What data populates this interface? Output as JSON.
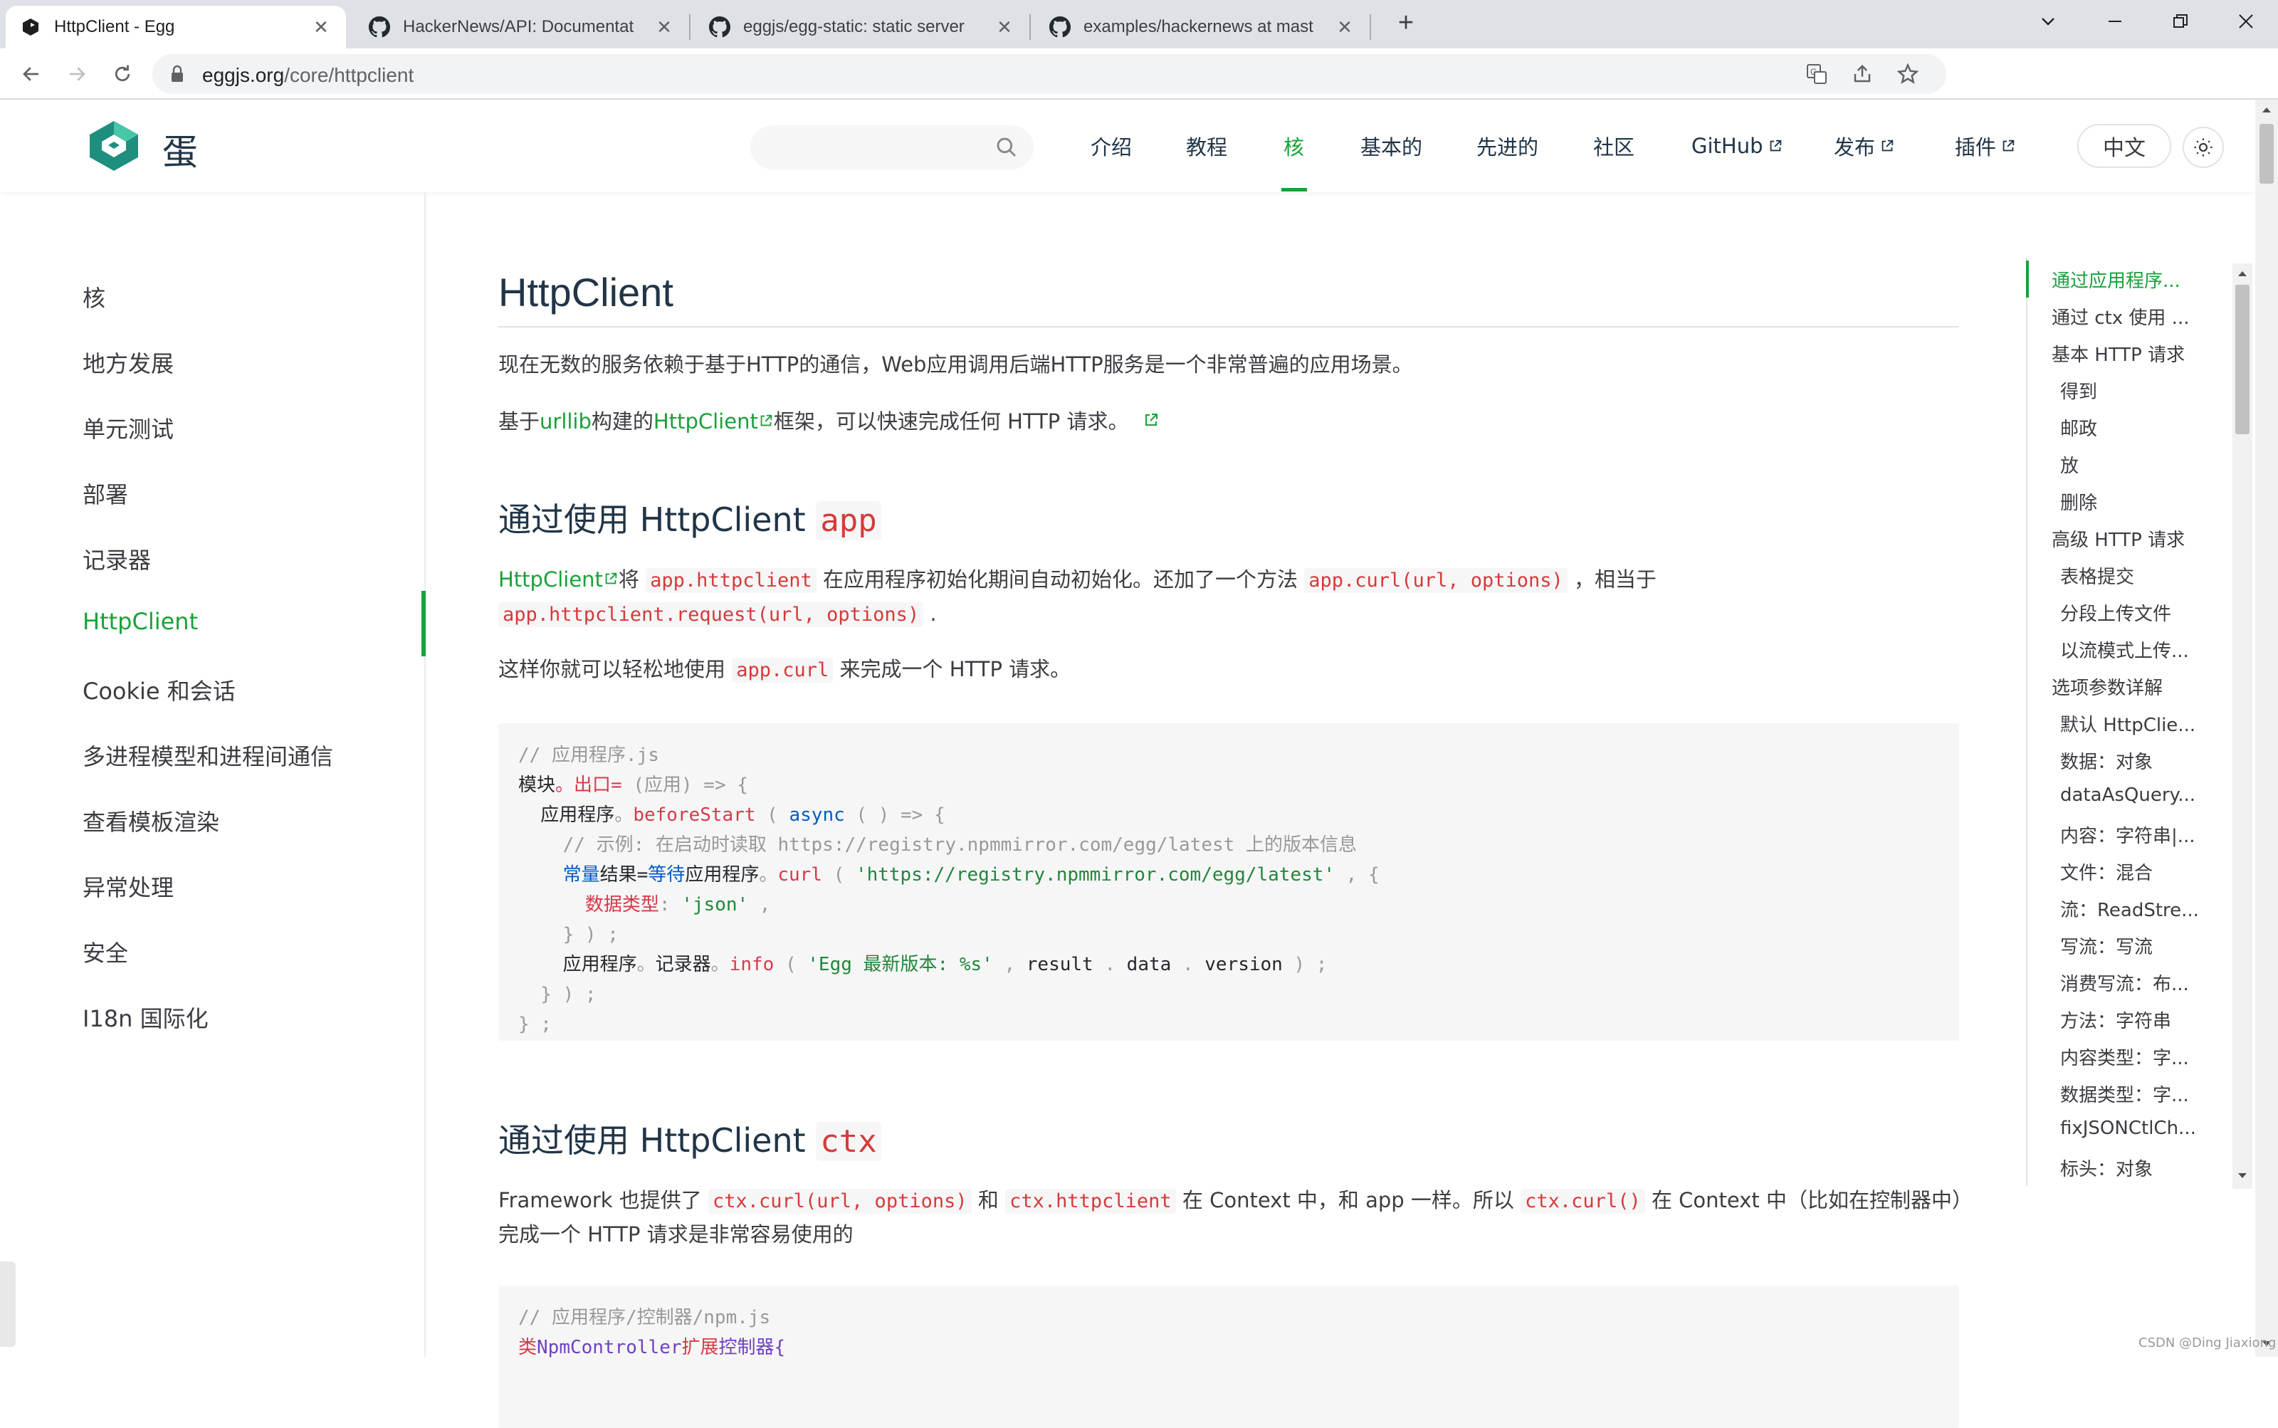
{
  "browser": {
    "tabs": [
      {
        "title": "HttpClient - Egg",
        "favicon": "egg-logo-icon",
        "active": true
      },
      {
        "title": "HackerNews/API: Documentat",
        "favicon": "github-icon",
        "active": false
      },
      {
        "title": "eggjs/egg-static: static server",
        "favicon": "github-icon",
        "active": false
      },
      {
        "title": "examples/hackernews at mast",
        "favicon": "github-icon",
        "active": false
      }
    ],
    "url_host": "eggjs.org",
    "url_path": "/core/httpclient"
  },
  "header": {
    "logo_text": "蛋",
    "search_placeholder": "",
    "nav": [
      {
        "label": "介绍",
        "external": false,
        "active": false
      },
      {
        "label": "教程",
        "external": false,
        "active": false
      },
      {
        "label": "核",
        "external": false,
        "active": true
      },
      {
        "label": "基本的",
        "external": false,
        "active": false
      },
      {
        "label": "先进的",
        "external": false,
        "active": false
      },
      {
        "label": "社区",
        "external": false,
        "active": false
      },
      {
        "label": "GitHub",
        "external": true,
        "active": false
      },
      {
        "label": "发布",
        "external": true,
        "active": false
      },
      {
        "label": "插件",
        "external": true,
        "active": false
      }
    ],
    "lang": "中文",
    "accent": "#19a13a"
  },
  "sidebar": {
    "items": [
      {
        "label": "核",
        "active": false
      },
      {
        "label": "地方发展",
        "active": false
      },
      {
        "label": "单元测试",
        "active": false
      },
      {
        "label": "部署",
        "active": false
      },
      {
        "label": "记录器",
        "active": false
      },
      {
        "label": "HttpClient",
        "active": true
      },
      {
        "label": "Cookie 和会话",
        "active": false
      },
      {
        "label": "多进程模型和进程间通信",
        "active": false
      },
      {
        "label": "查看模板渲染",
        "active": false
      },
      {
        "label": "异常处理",
        "active": false
      },
      {
        "label": "安全",
        "active": false
      },
      {
        "label": "I18n 国际化",
        "active": false
      }
    ]
  },
  "main": {
    "title": "HttpClient",
    "intro1": "现在无数的服务依赖于基于HTTP的通信，Web应用调用后端HTTP服务是一个非常普遍的应用场景。",
    "intro2_pre": "基于",
    "intro2_link1": "urllib",
    "intro2_mid": "构建的",
    "intro2_link2": "HttpClient",
    "intro2_post": "框架，可以快速完成任何 HTTP 请求。",
    "s1_title": "通过使用 HttpClient",
    "s1_code": "app",
    "s1_p1_link": "HttpClient",
    "s1_p1_a": "将",
    "s1_p1_code1": "app.httpclient",
    "s1_p1_b": "在应用程序初始化期间自动初始化。还加了一个方法",
    "s1_p1_code2": "app.curl(url, options)",
    "s1_p1_c": "，相当于",
    "s1_p1_code3": "app.httpclient.request(url, options)",
    "s1_p1_d": ".",
    "s1_p2_a": "这样你就可以轻松地使用",
    "s1_p2_code": "app.curl",
    "s1_p2_b": "来完成一个 HTTP 请求。",
    "code1": {
      "l1": "// 应用程序.js",
      "l2a": "模块",
      "l2b": "。出口=",
      "l2c": " (应用) => {",
      "l3a": "  应用程序",
      "l3b": "。",
      "l3c": "beforeStart",
      "l3d": " ( ",
      "l3e": "async",
      "l3f": " ( ) => {",
      "l4": "    // 示例: 在启动时读取 https://registry.npmmirror.com/egg/latest 上的版本信息",
      "l5a": "    ",
      "l5b": "常量",
      "l5c": "结果=",
      "l5d": "等待",
      "l5e": "应用程序",
      "l5f": "。",
      "l5g": "curl",
      "l5h": " ( ",
      "l5i": "'https://registry.npmmirror.com/egg/latest'",
      "l5j": " , {",
      "l6a": "      数据类型",
      "l6b": ": ",
      "l6c": "'json'",
      "l6d": " ,",
      "l7": "    } ) ;",
      "l8a": "    应用程序",
      "l8b": "。",
      "l8c": "记录器",
      "l8d": "。",
      "l8e": "info",
      "l8f": " ( ",
      "l8g": "'Egg 最新版本: %s'",
      "l8h": " , ",
      "l8i": "result",
      "l8j": " . ",
      "l8k": "data",
      "l8l": " . ",
      "l8m": "version",
      "l8n": " ) ;",
      "l9": "  } ) ;",
      "l10": "} ;"
    },
    "s2_title": "通过使用 HttpClient",
    "s2_code": "ctx",
    "s2_p1_a": "Framework 也提供了",
    "s2_p1_code1": "ctx.curl(url, options)",
    "s2_p1_b": "和",
    "s2_p1_code2": "ctx.httpclient",
    "s2_p1_c": "在 Context 中，和 app 一样。所以",
    "s2_p1_code3": "ctx.curl()",
    "s2_p1_d": "在 Context 中（比如在控制器中）",
    "s2_p1_e": "完成一个 HTTP 请求是非常容易使用的",
    "code2_l1": "// 应用程序/控制器/npm.js",
    "code2_l2a": "类",
    "code2_l2b": "NpmController",
    "code2_l2c": "扩展",
    "code2_l2d": "控制器{"
  },
  "toc": {
    "items": [
      {
        "label": "通过应用程序...",
        "indent": false,
        "active": true
      },
      {
        "label": "通过 ctx 使用 ...",
        "indent": false,
        "active": false
      },
      {
        "label": "基本 HTTP 请求",
        "indent": false,
        "active": false
      },
      {
        "label": "得到",
        "indent": true,
        "active": false
      },
      {
        "label": "邮政",
        "indent": true,
        "active": false
      },
      {
        "label": "放",
        "indent": true,
        "active": false
      },
      {
        "label": "删除",
        "indent": true,
        "active": false
      },
      {
        "label": "高级 HTTP 请求",
        "indent": false,
        "active": false
      },
      {
        "label": "表格提交",
        "indent": true,
        "active": false
      },
      {
        "label": "分段上传文件",
        "indent": true,
        "active": false
      },
      {
        "label": "以流模式上传...",
        "indent": true,
        "active": false
      },
      {
        "label": "选项参数详解",
        "indent": false,
        "active": false
      },
      {
        "label": "默认 HttpClie...",
        "indent": true,
        "active": false
      },
      {
        "label": "数据：对象",
        "indent": true,
        "active": false
      },
      {
        "label": "dataAsQuery...",
        "indent": true,
        "active": false
      },
      {
        "label": "内容：字符串|...",
        "indent": true,
        "active": false
      },
      {
        "label": "文件：混合",
        "indent": true,
        "active": false
      },
      {
        "label": "流：ReadStre...",
        "indent": true,
        "active": false
      },
      {
        "label": "写流：写流",
        "indent": true,
        "active": false
      },
      {
        "label": "消费写流：布...",
        "indent": true,
        "active": false
      },
      {
        "label": "方法：字符串",
        "indent": true,
        "active": false
      },
      {
        "label": "内容类型：字...",
        "indent": true,
        "active": false
      },
      {
        "label": "数据类型：字...",
        "indent": true,
        "active": false
      },
      {
        "label": "fixJSONCtlCh...",
        "indent": true,
        "active": false
      },
      {
        "label": "标头：对象",
        "indent": true,
        "active": false
      }
    ]
  },
  "watermark": "CSDN @Ding Jiaxiong"
}
